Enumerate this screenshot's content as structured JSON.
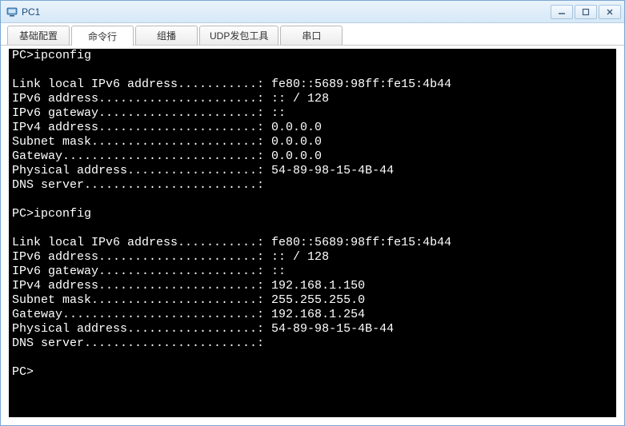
{
  "window": {
    "title": "PC1"
  },
  "tabs": [
    {
      "label": "基础配置"
    },
    {
      "label": "命令行"
    },
    {
      "label": "组播"
    },
    {
      "label": "UDP发包工具"
    },
    {
      "label": "串口"
    }
  ],
  "terminal": {
    "lines": [
      "PC>ipconfig",
      "",
      "Link local IPv6 address...........: fe80::5689:98ff:fe15:4b44",
      "IPv6 address......................: :: / 128",
      "IPv6 gateway......................: ::",
      "IPv4 address......................: 0.0.0.0",
      "Subnet mask.......................: 0.0.0.0",
      "Gateway...........................: 0.0.0.0",
      "Physical address..................: 54-89-98-15-4B-44",
      "DNS server........................:",
      "",
      "PC>ipconfig",
      "",
      "Link local IPv6 address...........: fe80::5689:98ff:fe15:4b44",
      "IPv6 address......................: :: / 128",
      "IPv6 gateway......................: ::",
      "IPv4 address......................: 192.168.1.150",
      "Subnet mask.......................: 255.255.255.0",
      "Gateway...........................: 192.168.1.254",
      "Physical address..................: 54-89-98-15-4B-44",
      "DNS server........................:",
      "",
      "PC>"
    ]
  }
}
